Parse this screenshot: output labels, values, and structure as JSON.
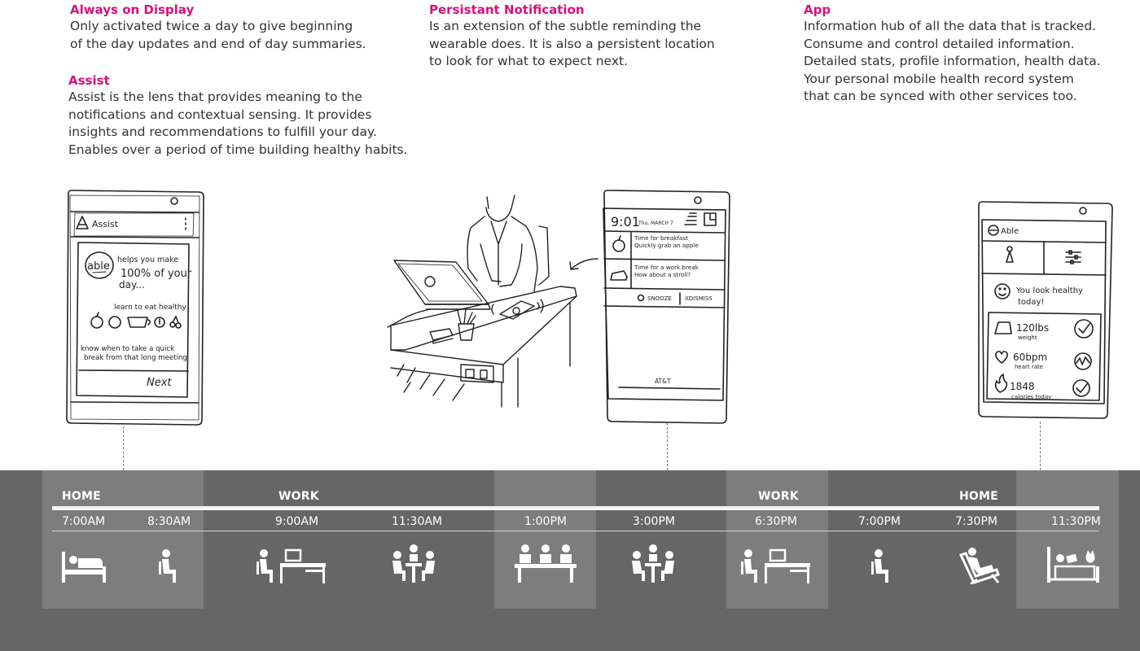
{
  "descriptions": {
    "always_on": {
      "title": "Always on Display",
      "lines": [
        "Only activated twice a day to give beginning",
        "of the day updates and end of day summaries."
      ]
    },
    "assist": {
      "title": "Assist",
      "lines": [
        "Assist is the lens that provides meaning to the",
        "notifications and contextual sensing. It provides",
        "insights and recommendations to fulfill your day.",
        "Enables over a period of time building healthy habits."
      ]
    },
    "notification": {
      "title": "Persistant Notification",
      "lines": [
        "Is an extension of the subtle reminding the",
        "wearable does. It is also a persistent location",
        "to look for what to expect next."
      ]
    },
    "app": {
      "title": "App",
      "lines": [
        "Information hub of all the data that is tracked.",
        "Consume and control detailed information.",
        "Detailed stats, profile information, health data.",
        "Your personal mobile health record system",
        "that can be synced with other services too."
      ]
    }
  },
  "phone_assist": {
    "header": "Assist",
    "logo": "able",
    "helps_line1": "helps you make",
    "helps_line2": "100% of your",
    "helps_line3": "day...",
    "learn": "learn to eat healthy",
    "know_line1": "know when to take a quick",
    "know_line2": "break from that long meeting",
    "next": "Next"
  },
  "phone_notification": {
    "time": "9:01",
    "date": "Thu, MARCH 7",
    "n1_line1": "Time for breakfast",
    "n1_line2": "Quickly grab an apple",
    "n2_line1": "Time for a work break",
    "n2_line2": "How about a stroll?",
    "snooze": "SNOOZE",
    "dismiss": "XDISMISS",
    "carrier": "AT&T"
  },
  "phone_app": {
    "header": "Able",
    "greeting_line1": "You look healthy",
    "greeting_line2": "today!",
    "stats": [
      {
        "value": "120lbs",
        "label": "weight",
        "icon": "scale-icon"
      },
      {
        "value": "60bpm",
        "label": "heart rate",
        "icon": "heart-icon"
      },
      {
        "value": "1848",
        "label": "calories today",
        "icon": "flame-icon"
      }
    ]
  },
  "timeline": {
    "places": [
      {
        "label": "HOME"
      },
      {
        "label": "WORK"
      },
      {
        "label": "WORK"
      },
      {
        "label": "HOME"
      }
    ],
    "times": [
      "7:00AM",
      "8:30AM",
      "9:00AM",
      "11:30AM",
      "1:00PM",
      "3:00PM",
      "6:30PM",
      "7:00PM",
      "7:30PM",
      "11:30PM"
    ],
    "icons": [
      "bed-icon",
      "seated-person-icon",
      "person-at-desk-icon",
      "meeting-icon",
      "group-table-icon",
      "meeting-icon",
      "person-at-desk-icon",
      "seated-person-icon",
      "lounge-chair-icon",
      "bed-with-cat-icon"
    ],
    "colors": {
      "band": "#666666",
      "highlight": "#7d7d7d",
      "accent": "#d4127e"
    }
  }
}
